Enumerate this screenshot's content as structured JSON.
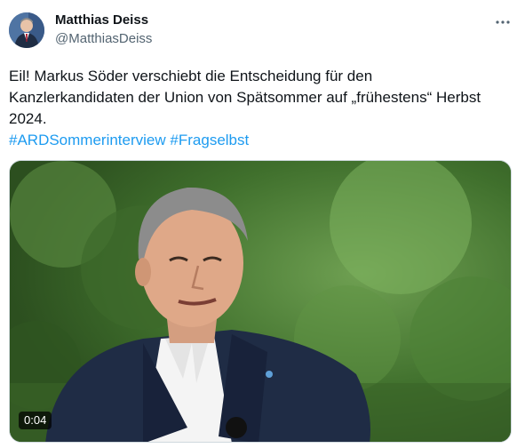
{
  "author": {
    "name": "Matthias Deiss",
    "handle": "@MatthiasDeiss"
  },
  "more_icon": "more-horizontal-icon",
  "tweet": {
    "text_line1": "Eil! Markus Söder verschiebt die Entscheidung für den",
    "text_line2": "Kanzlerkandidaten der Union von Spätsommer auf „frühestens“ Herbst",
    "text_line3": "2024.",
    "hashtag1": "#ARDSommerinterview",
    "hashtag2": "#Fragselbst"
  },
  "video": {
    "duration": "0:04"
  },
  "colors": {
    "link": "#1d9bf0",
    "secondary_text": "#536471",
    "primary_text": "#0f1419"
  }
}
